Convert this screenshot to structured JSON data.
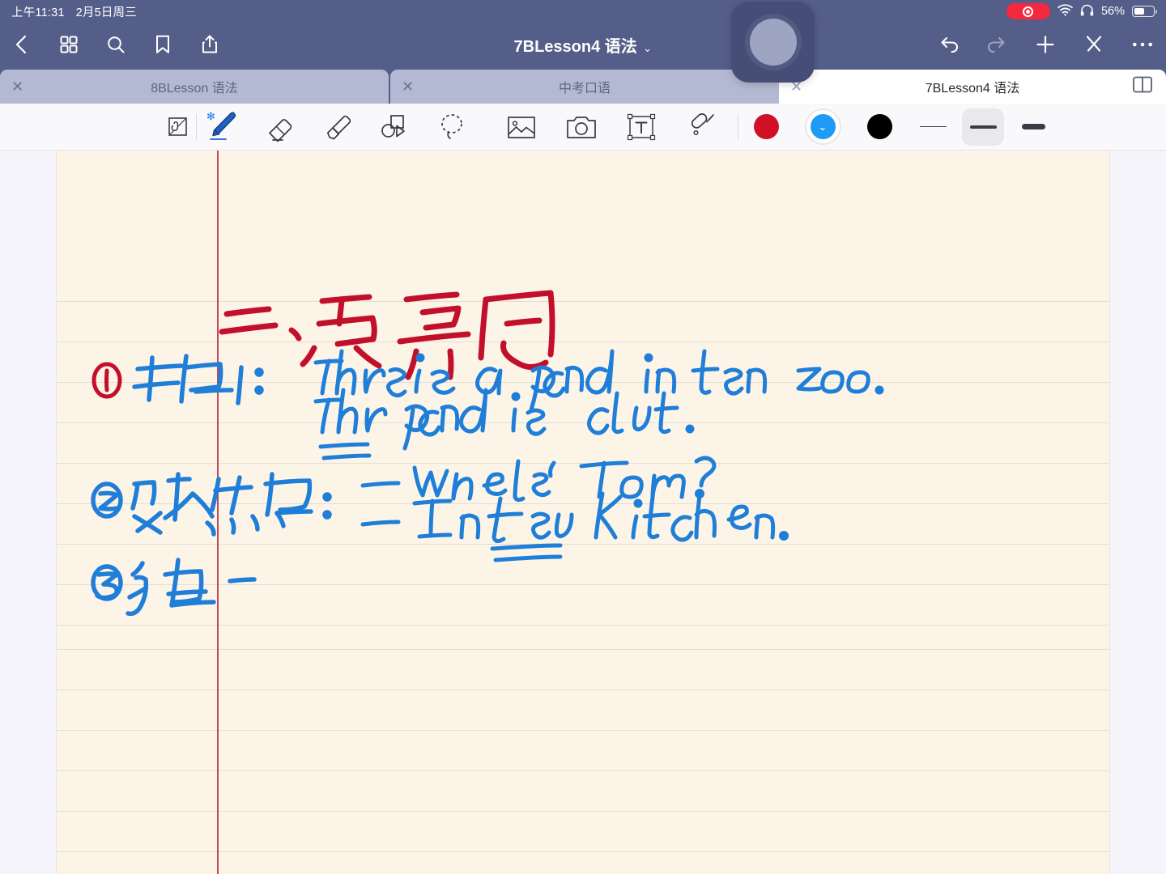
{
  "status_bar": {
    "time": "上午11:31",
    "date": "2月5日周三",
    "battery_percent": "56%",
    "icons": [
      "record-indicator",
      "wifi-icon",
      "headphones-icon",
      "battery-icon"
    ]
  },
  "title_bar": {
    "title": "7BLesson4 语法",
    "chevron": "⌄",
    "left_buttons": [
      {
        "name": "back-button",
        "icon": "chevron-left-icon"
      },
      {
        "name": "thumbnails-button",
        "icon": "grid-icon"
      },
      {
        "name": "search-button",
        "icon": "search-icon"
      },
      {
        "name": "bookmark-button",
        "icon": "bookmark-icon"
      },
      {
        "name": "share-button",
        "icon": "share-icon"
      }
    ],
    "right_buttons": [
      {
        "name": "undo-button",
        "icon": "undo-icon",
        "enabled": "true"
      },
      {
        "name": "redo-button",
        "icon": "redo-icon",
        "enabled": "false"
      },
      {
        "name": "add-page-button",
        "icon": "plus-icon"
      },
      {
        "name": "cut-button",
        "icon": "scissors-icon"
      },
      {
        "name": "more-button",
        "icon": "ellipsis-icon"
      }
    ]
  },
  "tabs": [
    {
      "label": "8BLesson 语法",
      "active": "false"
    },
    {
      "label": "中考口语",
      "active": "false"
    },
    {
      "label": "7BLesson4 语法",
      "active": "true"
    }
  ],
  "tab_bar": {
    "close_glyph": "✕",
    "split_view_icon": "split-view-icon"
  },
  "toolbar": {
    "tools": [
      {
        "name": "palm-rejection-tool",
        "icon": "hand-page-icon",
        "active": "false"
      },
      {
        "name": "pen-tool",
        "icon": "pen-icon",
        "active": "true",
        "badge": "bluetooth"
      },
      {
        "name": "eraser-tool",
        "icon": "eraser-icon",
        "active": "false"
      },
      {
        "name": "highlighter-tool",
        "icon": "highlighter-icon",
        "active": "false"
      },
      {
        "name": "shapes-tool",
        "icon": "shapes-icon",
        "active": "false"
      },
      {
        "name": "lasso-tool",
        "icon": "lasso-icon",
        "active": "false"
      },
      {
        "name": "image-tool",
        "icon": "image-icon",
        "active": "false"
      },
      {
        "name": "camera-tool",
        "icon": "camera-icon",
        "active": "false"
      },
      {
        "name": "text-tool",
        "icon": "textbox-icon",
        "active": "false"
      },
      {
        "name": "laser-pointer-tool",
        "icon": "laser-pointer-icon",
        "active": "false"
      }
    ],
    "bluetooth_badge": "✻",
    "colors": [
      {
        "name": "color-red",
        "hex": "#cf1026",
        "selected": "false"
      },
      {
        "name": "color-blue",
        "hex": "#1e9bf5",
        "selected": "true"
      },
      {
        "name": "color-black",
        "hex": "#000000",
        "selected": "false"
      }
    ],
    "selected_color_check": "⌄",
    "widths": [
      {
        "name": "width-thin",
        "selected": "false"
      },
      {
        "name": "width-medium",
        "selected": "true"
      },
      {
        "name": "width-thick",
        "selected": "false"
      }
    ]
  },
  "notebook": {
    "paper_color": "#fdf4e8",
    "rule_color": "#e2ddd3",
    "margin_line_color": "#c0485a",
    "ink_colors": {
      "red": "#c2102a",
      "blue": "#1f7ed8"
    },
    "handwriting": [
      {
        "id": "heading",
        "text": "二、定冠词",
        "color": "red"
      },
      {
        "id": "item-1-label",
        "text": "① 特指：",
        "color": "blue",
        "marker_color": "red"
      },
      {
        "id": "item-1-example-1",
        "text": "There is a panda in the zoo.",
        "color": "blue"
      },
      {
        "id": "item-1-example-2",
        "text": "The panda is cute.",
        "color": "blue",
        "underline": "The"
      },
      {
        "id": "item-2-label",
        "text": "② 双方熟悉：",
        "color": "blue"
      },
      {
        "id": "item-2-example-1",
        "text": "— Where's Tom?",
        "color": "blue"
      },
      {
        "id": "item-2-example-2",
        "text": "— In the kitchen.",
        "color": "blue",
        "underline": "the"
      },
      {
        "id": "item-3-label",
        "text": "③ 独 -",
        "color": "blue"
      }
    ]
  },
  "pip": {
    "name": "camera-preview-bubble",
    "lens_color": "#9ea5c2"
  }
}
